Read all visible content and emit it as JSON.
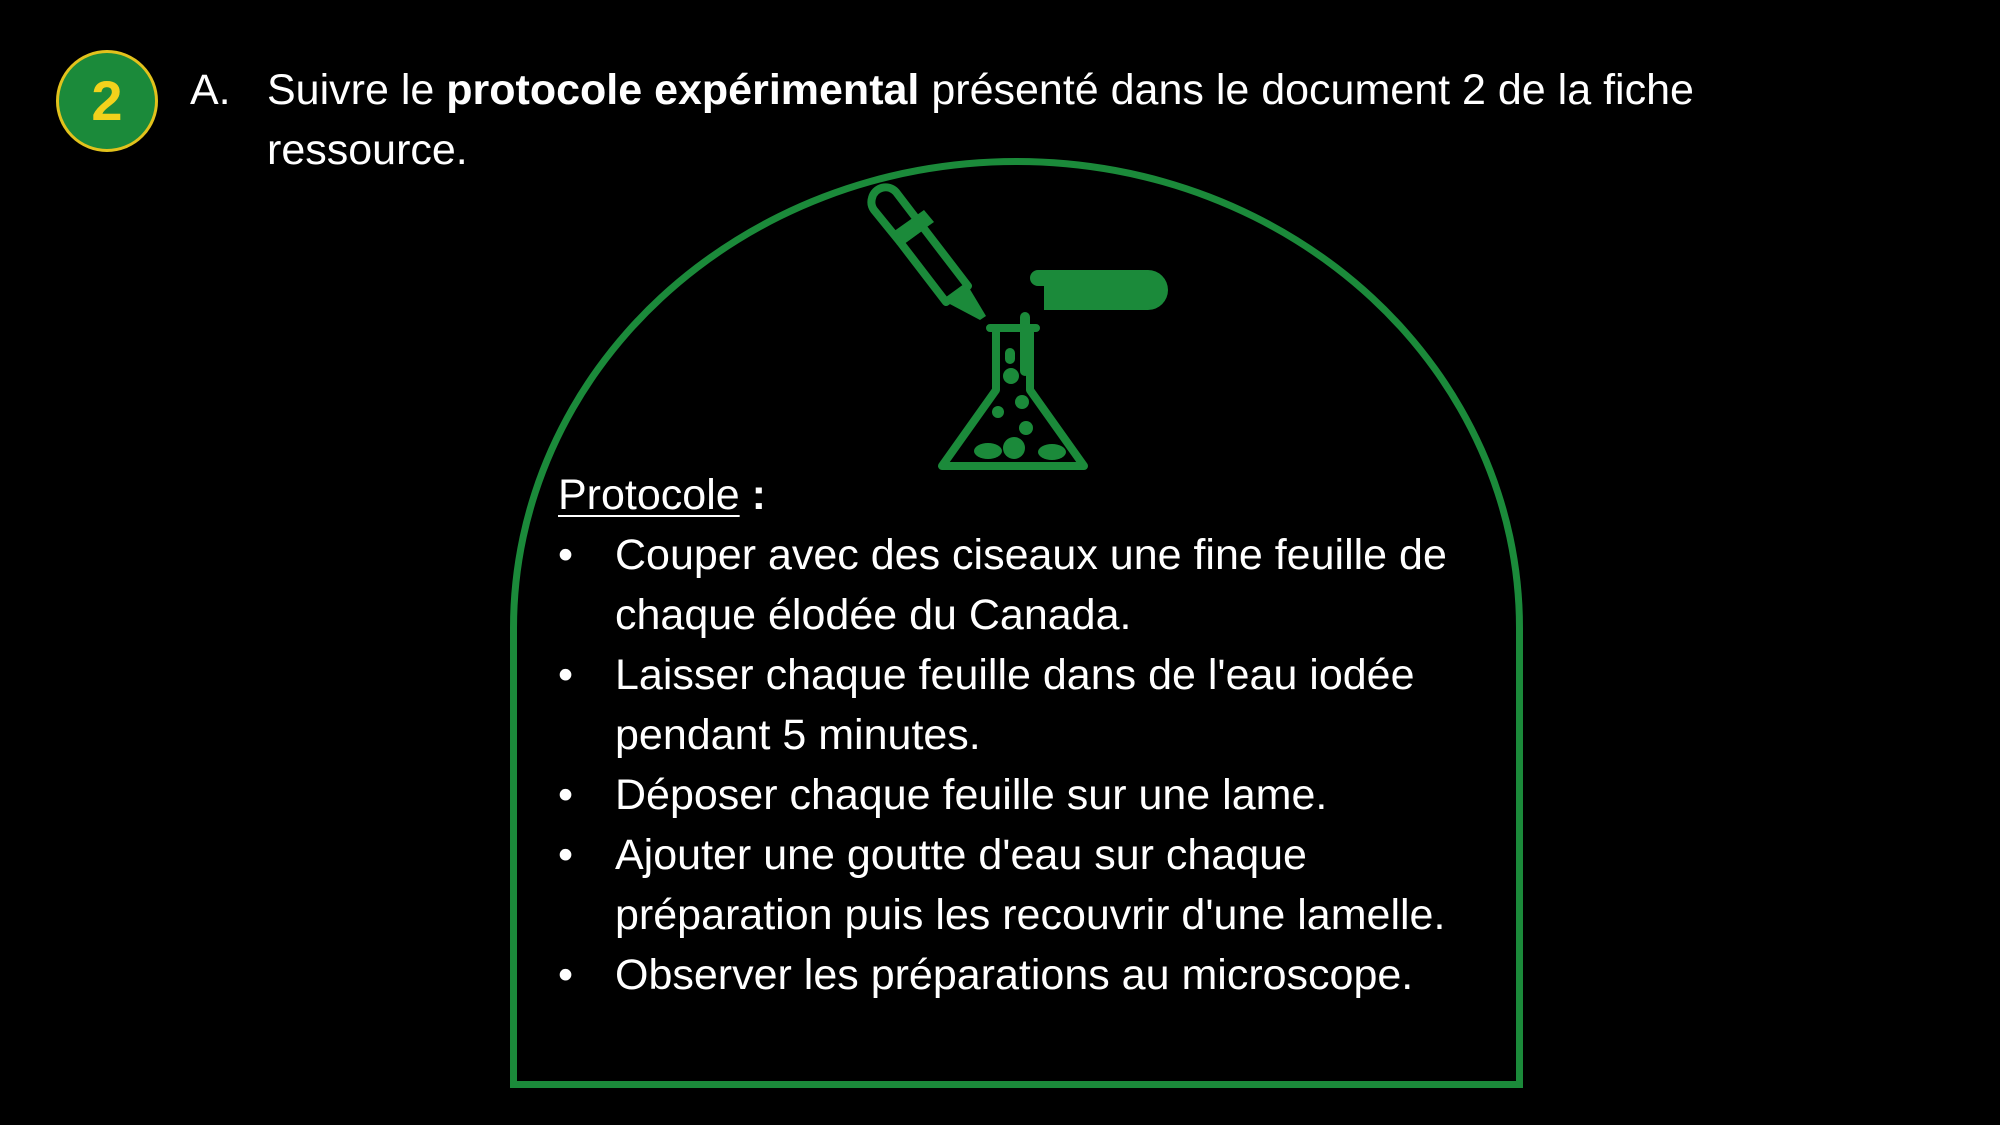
{
  "badge": {
    "number": "2"
  },
  "instruction": {
    "marker": "A.",
    "text_before": "Suivre le ",
    "text_bold": "protocole expérimental",
    "text_after": " présenté dans le document 2 de la fiche ressource."
  },
  "protocol": {
    "title": "Protocole",
    "title_colon": " :",
    "bullet": "•",
    "steps": [
      "Couper avec des ciseaux une fine feuille de chaque élodée du Canada.",
      "Laisser chaque feuille dans de l'eau iodée pendant 5 minutes.",
      "Déposer chaque feuille sur une lame.",
      "Ajouter une goutte d'eau sur chaque préparation puis les recouvrir d'une lamelle.",
      "Observer les préparations au microscope."
    ]
  },
  "icons": {
    "lab": "lab-experiment-icon"
  },
  "colors": {
    "background": "#000000",
    "accent_green": "#1b8a3a",
    "badge_number": "#f2d21c",
    "text": "#ffffff"
  }
}
